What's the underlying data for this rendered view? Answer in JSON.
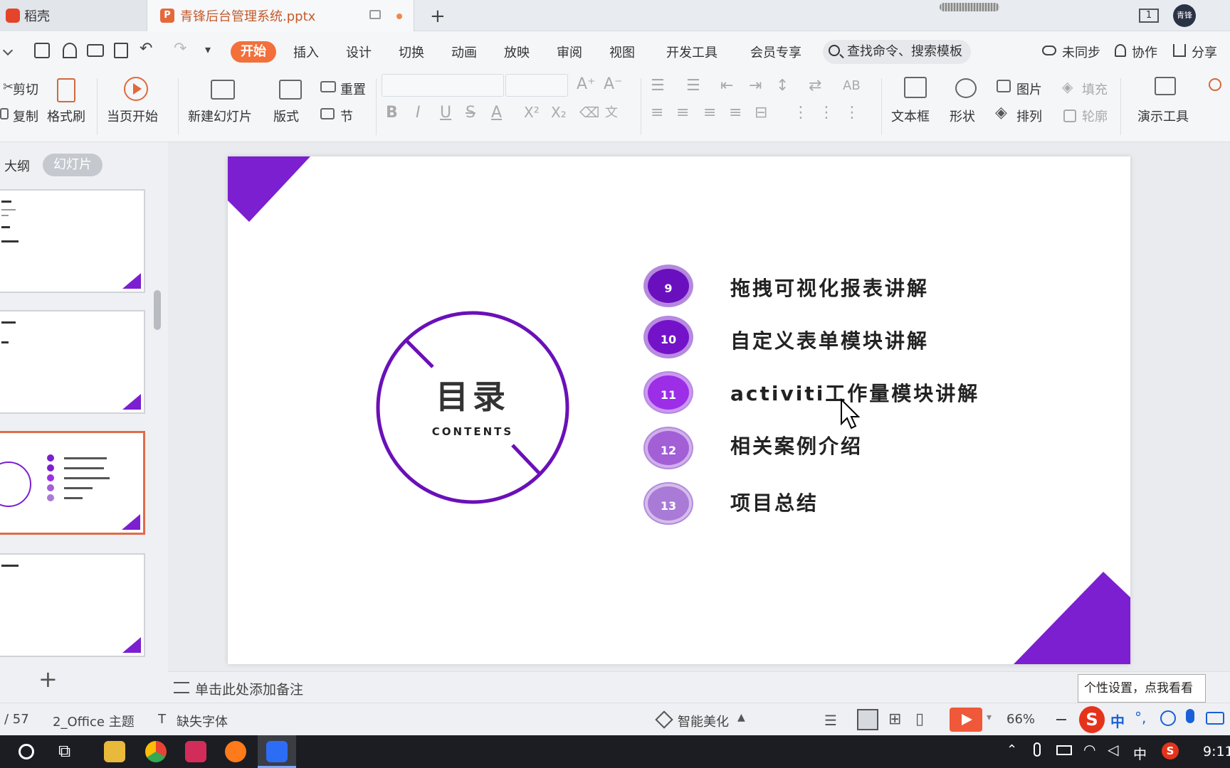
{
  "tabs": {
    "home": "稻壳",
    "doc": "青锋后台管理系统.pptx",
    "new_tab": "+"
  },
  "titlebar": {
    "page_indicator": "1",
    "avatar_text": "青锋"
  },
  "menu": {
    "items": [
      "开始",
      "插入",
      "设计",
      "切换",
      "动画",
      "放映",
      "审阅",
      "视图",
      "开发工具",
      "会员专享"
    ],
    "search_placeholder": "查找命令、搜索模板",
    "right": {
      "sync": "未同步",
      "collab": "协作",
      "share": "分享"
    }
  },
  "ribbon": {
    "cut": "剪切",
    "copy": "复制",
    "format_painter": "格式刷",
    "start_from_current": "当页开始",
    "new_slide": "新建幻灯片",
    "layout": "版式",
    "reset": "重置",
    "section": "节",
    "textbox": "文本框",
    "shape": "形状",
    "picture": "图片",
    "fill": "填充",
    "arrange": "排列",
    "outline": "轮廓",
    "presenter_tools": "演示工具",
    "font_buttons": [
      "B",
      "I",
      "U",
      "S",
      "A"
    ]
  },
  "left_panel": {
    "view_outline": "大纲",
    "view_slides": "幻灯片",
    "add_slide": "+"
  },
  "slide": {
    "title": "目录",
    "subtitle": "CONTENTS",
    "items": [
      {
        "num": "9",
        "text": "拖拽可视化报表讲解",
        "color": "#6a0fbe"
      },
      {
        "num": "10",
        "text": "自定义表单模块讲解",
        "color": "#7412c9"
      },
      {
        "num": "11",
        "text": "activiti工作量模块讲解",
        "color": "#9b2ee6"
      },
      {
        "num": "12",
        "text": "相关案例介绍",
        "color": "#a25fd6"
      },
      {
        "num": "13",
        "text": "项目总结",
        "color": "#a97ad6"
      }
    ],
    "accent_color": "#7b1fd0"
  },
  "notes": {
    "placeholder": "单击此处添加备注"
  },
  "tooltip": "个性设置，点我看看",
  "statusbar": {
    "page": "/ 57",
    "theme": "2_Office 主题",
    "missing_font": "缺失字体",
    "beautify": "智能美化",
    "zoom": "66%"
  },
  "taskbar": {
    "ime": "中",
    "time": "9:11"
  }
}
